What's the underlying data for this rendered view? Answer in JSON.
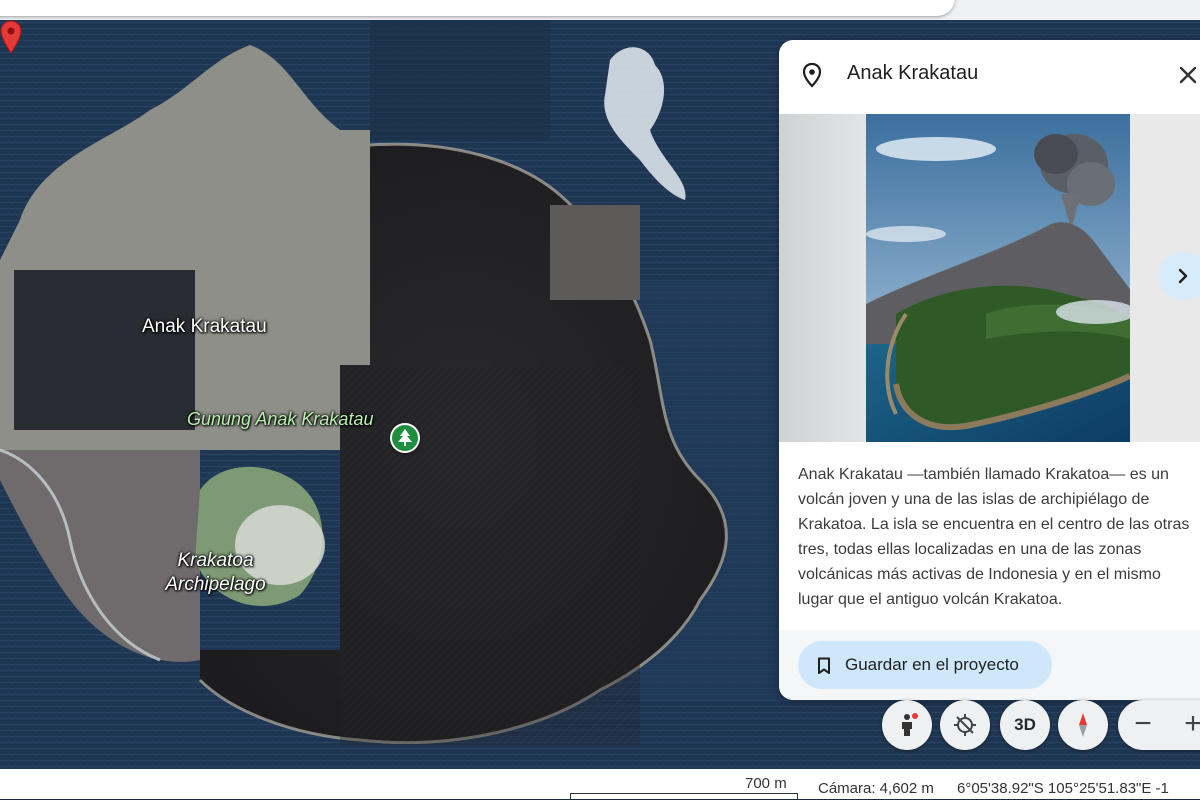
{
  "map": {
    "labels": {
      "island_name": "Anak Krakatau",
      "peak_name": "Gunung Anak Krakatau",
      "archipelago_line1": "Krakatoa",
      "archipelago_line2": "Archipelago"
    }
  },
  "panel": {
    "title": "Anak Krakatau",
    "description": "Anak Krakatau —también llamado Krakatoa— es un volcán joven y una de las islas de archipiélago de Krakatoa. La isla se encuentra en el centro de las otras tres, todas ellas localizadas en una de las zonas volcánicas más activas de Indonesia y en el mismo lugar que el antiguo volcán Krakatoa.",
    "save_button_label": "Guardar en el proyecto"
  },
  "controls": {
    "three_d_label": "3D",
    "zoom_out_label": "−",
    "zoom_in_label": "+"
  },
  "status": {
    "scale_label": "700 m",
    "camera": "Cámara: 4,602 m",
    "coordinates": "6°05'38.92\"S 105°25'51.83\"E   -1"
  },
  "colors": {
    "accent_button": "#cfe7fa",
    "pin_red": "#e53935",
    "park_green": "#1e8e3e"
  },
  "icons": [
    "location-pin-icon",
    "close-icon",
    "chevron-right-icon",
    "bookmark-icon",
    "pegman-icon",
    "tilt-icon",
    "compass-icon",
    "tree-icon",
    "map-marker-icon"
  ]
}
